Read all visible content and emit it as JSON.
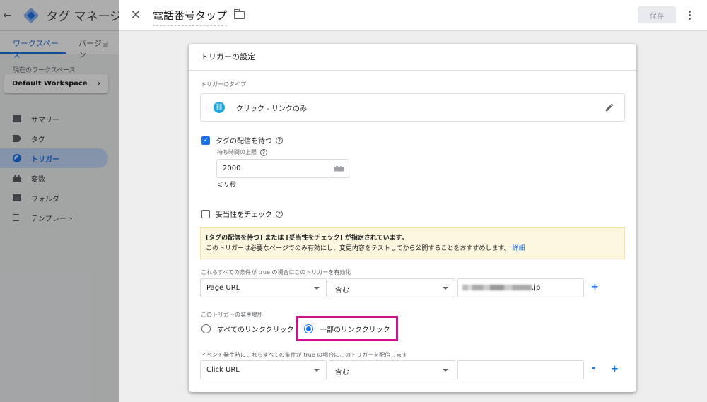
{
  "app": {
    "title": "タグ マネージャー",
    "tabs": [
      "ワークスペース",
      "バージョン"
    ],
    "workspace_label": "現在のワークスペース",
    "workspace_name": "Default Workspace",
    "nav": [
      {
        "label": "サマリー",
        "icon": "folder-icon"
      },
      {
        "label": "タグ",
        "icon": "tag-icon"
      },
      {
        "label": "トリガー",
        "icon": "trigger-icon"
      },
      {
        "label": "変数",
        "icon": "variable-icon"
      },
      {
        "label": "フォルダ",
        "icon": "folder-icon"
      },
      {
        "label": "テンプレート",
        "icon": "template-icon"
      }
    ]
  },
  "panel": {
    "name": "電話番号タップ",
    "save_label": "保存"
  },
  "card": {
    "title": "トリガーの設定",
    "type_label": "トリガーのタイプ",
    "type_name": "クリック - リンクのみ",
    "wait_tags_label": "タグの配信を待つ",
    "wait_limit_label": "待ち時間の上限",
    "wait_value": "2000",
    "wait_unit": "ミリ秒",
    "check_validation_label": "妥当性をチェック",
    "notice_title": "[タグの配信を待つ] または [妥当性をチェック] が指定されています。",
    "notice_body": "このトリガーは必要なページでのみ有効にし、変更内容をテストしてから公開することをおすすめします。",
    "notice_link": "詳細",
    "enable_label": "これらすべての条件が true の場合にこのトリガーを有効化",
    "enable_condition": {
      "variable": "Page URL",
      "operator": "含む",
      "value_suffix": ".jp"
    },
    "fire_on_label": "このトリガーの発生場所",
    "radio_all": "すべてのリンククリック",
    "radio_some": "一部のリンククリック",
    "fire_condition_label": "イベント発生時にこれらすべての条件が true の場合にこのトリガーを配信します",
    "fire_condition": {
      "variable": "Click URL",
      "operator": "含む",
      "value": ""
    },
    "plus": "+",
    "minus": "-"
  },
  "colors": {
    "accent": "#1a73e8",
    "highlight": "#d0108f",
    "notice_bg": "#fef7e0"
  }
}
